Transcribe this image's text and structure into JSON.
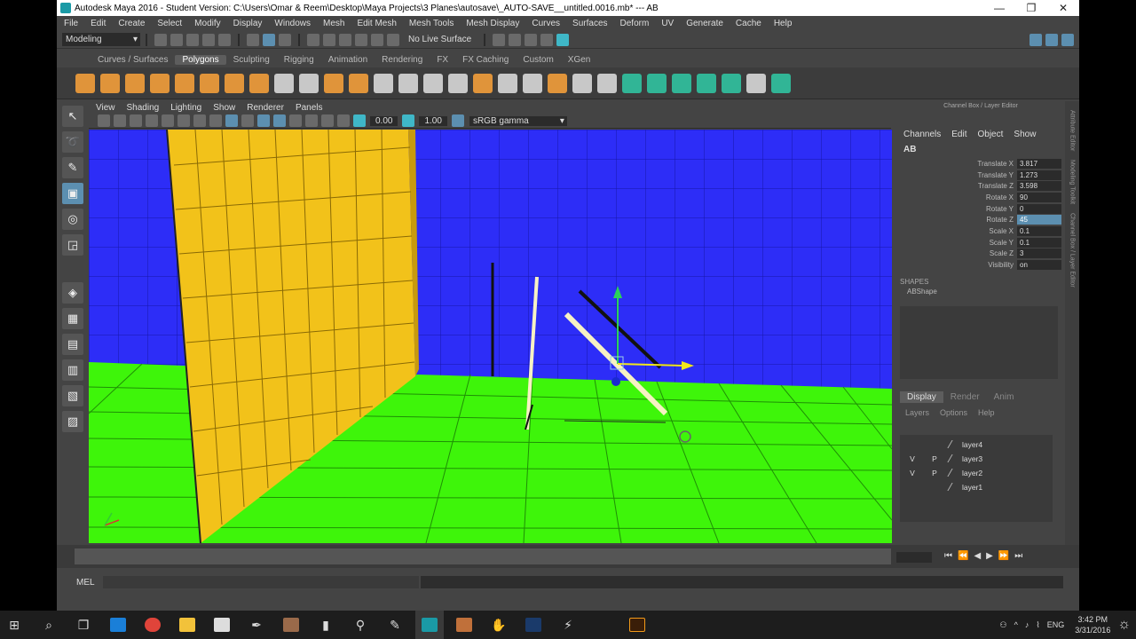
{
  "window": {
    "title": "Autodesk Maya 2016 - Student Version: C:\\Users\\Omar & Reem\\Desktop\\Maya Projects\\3 Planes\\autosave\\_AUTO-SAVE__untitled.0016.mb*  ---  AB",
    "minimize": "—",
    "maximize": "❐",
    "close": "✕"
  },
  "menubar": [
    "File",
    "Edit",
    "Create",
    "Select",
    "Modify",
    "Display",
    "Windows",
    "Mesh",
    "Edit Mesh",
    "Mesh Tools",
    "Mesh Display",
    "Curves",
    "Surfaces",
    "Deform",
    "UV",
    "Generate",
    "Cache",
    "Help"
  ],
  "statusline": {
    "menuset": "Modeling",
    "live_surface": "No Live Surface"
  },
  "shelf_tabs": [
    "Curves / Surfaces",
    "Polygons",
    "Sculpting",
    "Rigging",
    "Animation",
    "Rendering",
    "FX",
    "FX Caching",
    "Custom",
    "XGen"
  ],
  "shelf_active_tab": "Polygons",
  "viewport": {
    "menu": [
      "View",
      "Shading",
      "Lighting",
      "Show",
      "Renderer",
      "Panels"
    ],
    "exposure": "0.00",
    "gamma_value": "1.00",
    "color_space": "sRGB gamma"
  },
  "channel_box": {
    "title": "Channel Box / Layer Editor",
    "menu": [
      "Channels",
      "Edit",
      "Object",
      "Show"
    ],
    "object_name": "AB",
    "attributes": [
      {
        "label": "Translate X",
        "value": "3.817"
      },
      {
        "label": "Translate Y",
        "value": "1.273"
      },
      {
        "label": "Translate Z",
        "value": "3.598"
      },
      {
        "label": "Rotate X",
        "value": "90"
      },
      {
        "label": "Rotate Y",
        "value": "0"
      },
      {
        "label": "Rotate Z",
        "value": "45"
      },
      {
        "label": "Scale X",
        "value": "0.1"
      },
      {
        "label": "Scale Y",
        "value": "0.1"
      },
      {
        "label": "Scale Z",
        "value": "3"
      },
      {
        "label": "Visibility",
        "value": "on"
      }
    ],
    "shapes_header": "SHAPES",
    "shape_name": "ABShape"
  },
  "layer_editor": {
    "tabs": [
      "Display",
      "Render",
      "Anim"
    ],
    "menu": [
      "Layers",
      "Options",
      "Help"
    ],
    "layers": [
      {
        "v": "",
        "p": "",
        "name": "layer4"
      },
      {
        "v": "V",
        "p": "P",
        "name": "layer3"
      },
      {
        "v": "V",
        "p": "P",
        "name": "layer2"
      },
      {
        "v": "",
        "p": "",
        "name": "layer1"
      }
    ]
  },
  "side_tabs": [
    "Attribute Editor",
    "Modeling Toolkit",
    "Channel Box / Layer Editor"
  ],
  "command_line": {
    "label": "MEL"
  },
  "taskbar": {
    "language": "ENG",
    "time": "3:42 PM",
    "date": "3/31/2016"
  },
  "colors": {
    "wall_blue": "#2d2df7",
    "wall_yellow": "#f2c21a",
    "floor_green": "#3ef50a",
    "ui_gray": "#444444",
    "highlight": "#5c8fb0"
  }
}
